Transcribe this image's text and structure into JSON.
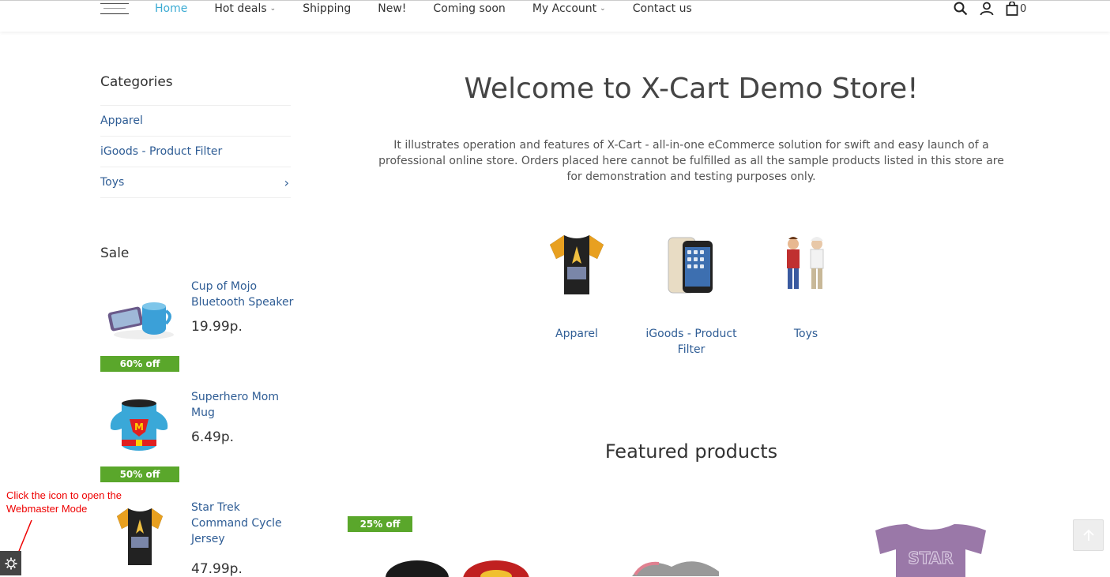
{
  "header": {
    "nav": [
      {
        "label": "Home",
        "active": true,
        "dropdown": false
      },
      {
        "label": "Hot deals",
        "active": false,
        "dropdown": true
      },
      {
        "label": "Shipping",
        "active": false,
        "dropdown": false
      },
      {
        "label": "New!",
        "active": false,
        "dropdown": false
      },
      {
        "label": "Coming soon",
        "active": false,
        "dropdown": false
      },
      {
        "label": "My Account",
        "active": false,
        "dropdown": true
      },
      {
        "label": "Contact us",
        "active": false,
        "dropdown": false
      }
    ],
    "icons": [
      "search-icon",
      "user-icon",
      "bag-icon"
    ],
    "cart_count": "0"
  },
  "sidebar": {
    "categories_title": "Categories",
    "categories": [
      {
        "label": "Apparel",
        "has_children": false
      },
      {
        "label": "iGoods - Product Filter",
        "has_children": false
      },
      {
        "label": "Toys",
        "has_children": true
      }
    ],
    "sale_title": "Sale",
    "sale_items": [
      {
        "name": "Cup of Mojo Bluetooth Speaker",
        "price": "19.99р.",
        "badge": "60% off"
      },
      {
        "name": "Superhero Mom Mug",
        "price": "6.49р.",
        "badge": "50% off"
      },
      {
        "name": "Star Trek Command Cycle Jersey",
        "price": "47.99р."
      }
    ]
  },
  "main": {
    "title": "Welcome to X-Cart Demo Store!",
    "intro": "It illustrates operation and features of X-Cart - all-in-one eCommerce solution for swift and easy launch of a professional online store. Orders placed here cannot be fulfilled as all the sample products listed in this store are for demonstration and testing purposes only.",
    "category_tiles": [
      {
        "label": "Apparel"
      },
      {
        "label": "iGoods - Product Filter"
      },
      {
        "label": "Toys"
      }
    ],
    "featured_title": "Featured products",
    "featured_badge": "25% off"
  },
  "webmaster_hint": "Click the icon to open the Webmaster Mode",
  "colors": {
    "accent": "#3cabd3",
    "link": "#2f5d95",
    "sale_badge": "#5aa72b",
    "hint": "#ee0000"
  }
}
